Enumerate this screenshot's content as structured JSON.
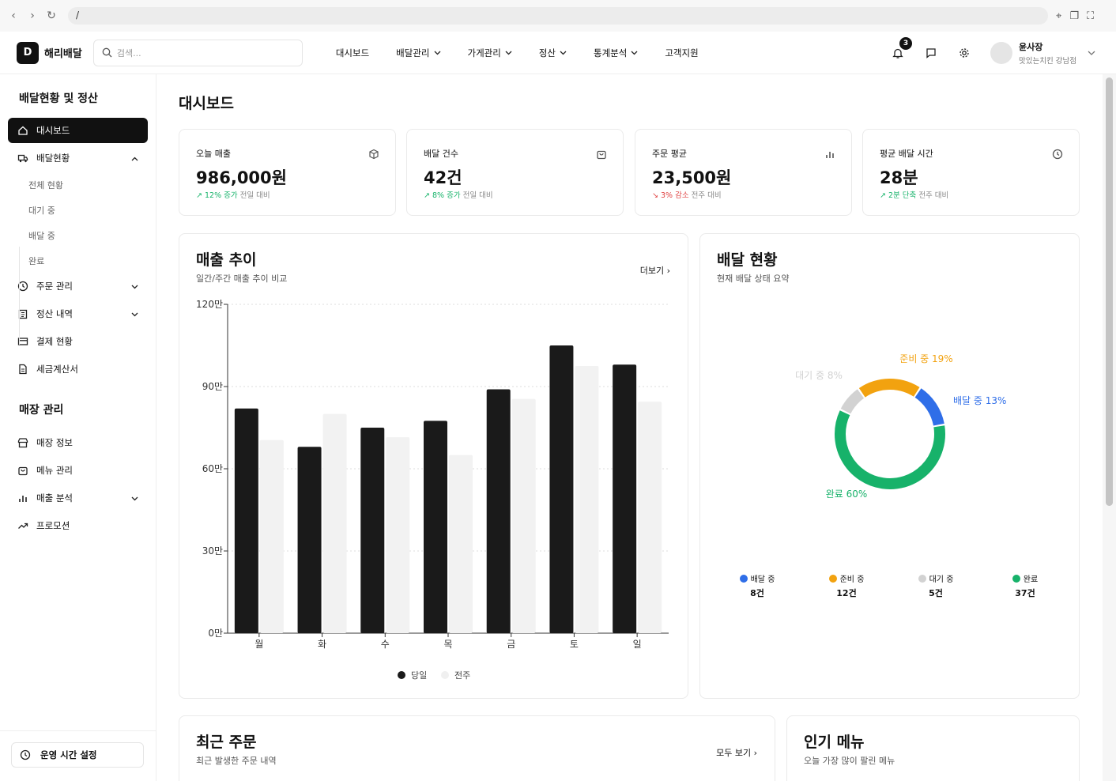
{
  "browser": {
    "url": "/"
  },
  "app": {
    "logo_letter": "D",
    "name": "해리배달",
    "search_placeholder": "검색..."
  },
  "topnav": {
    "items": [
      {
        "label": "대시보드",
        "dropdown": false
      },
      {
        "label": "배달관리",
        "dropdown": true
      },
      {
        "label": "가게관리",
        "dropdown": true
      },
      {
        "label": "정산",
        "dropdown": true
      },
      {
        "label": "통계분석",
        "dropdown": true
      },
      {
        "label": "고객지원",
        "dropdown": false
      }
    ],
    "notification_count": "3",
    "user_name": "윤사장",
    "user_store": "맛있는치킨 강남점"
  },
  "sidebar": {
    "section1_title": "배달현황 및 정산",
    "items": [
      {
        "label": "대시보드",
        "icon": "home-icon",
        "active": true
      },
      {
        "label": "배달현황",
        "icon": "truck-icon",
        "arrow": "up"
      },
      {
        "label": "주문 관리",
        "icon": "clock-icon",
        "arrow": "down"
      },
      {
        "label": "정산 내역",
        "icon": "clipboard-icon",
        "arrow": "down"
      },
      {
        "label": "결제 현황",
        "icon": "card-icon"
      },
      {
        "label": "세금계산서",
        "icon": "document-icon"
      }
    ],
    "sub_items": [
      "전체 현황",
      "대기 중",
      "배달 중",
      "완료"
    ],
    "section2_title": "매장 관리",
    "store_items": [
      {
        "label": "매장 정보",
        "icon": "store-icon"
      },
      {
        "label": "메뉴 관리",
        "icon": "bag-icon"
      },
      {
        "label": "매출 분석",
        "icon": "bar-chart-icon",
        "arrow": "down"
      },
      {
        "label": "프로모션",
        "icon": "trend-icon"
      }
    ],
    "footer_button": "운영 시간 설정"
  },
  "page": {
    "title": "대시보드"
  },
  "kpis": [
    {
      "label": "오늘 매출",
      "value": "986,000원",
      "delta": "12% 증가",
      "note": "전일 대비",
      "trend": "up",
      "icon": "box-icon"
    },
    {
      "label": "배달 건수",
      "value": "42건",
      "delta": "8% 증가",
      "note": "전일 대비",
      "trend": "up",
      "icon": "bag-icon"
    },
    {
      "label": "주문 평균",
      "value": "23,500원",
      "delta": "3% 감소",
      "note": "전주 대비",
      "trend": "down",
      "icon": "bar-chart-icon"
    },
    {
      "label": "평균 배달 시간",
      "value": "28분",
      "delta": "2분 단축",
      "note": "전주 대비",
      "trend": "up",
      "icon": "clock-icon"
    }
  ],
  "sales": {
    "title": "매출 추이",
    "subtitle": "일간/주간 매출 추이 비교",
    "more": "더보기",
    "legend": [
      "당일",
      "전주"
    ]
  },
  "delivery": {
    "title": "배달 현황",
    "subtitle": "현재 배달 상태 요약",
    "legend": [
      {
        "label": "배달 중",
        "count": "8건",
        "color": "#2f6ee8"
      },
      {
        "label": "준비 중",
        "count": "12건",
        "color": "#f2a20f"
      },
      {
        "label": "대기 중",
        "count": "5건",
        "color": "#d2d2d2"
      },
      {
        "label": "완료",
        "count": "37건",
        "color": "#17b26a"
      }
    ],
    "labels": {
      "waiting": "대기 중 8%",
      "preparing": "준비 중 19%",
      "delivering": "배달 중 13%",
      "done": "완료 60%"
    }
  },
  "recent": {
    "title": "최근 주문",
    "subtitle": "최근 발생한 주문 내역",
    "more": "모두 보기"
  },
  "popular": {
    "title": "인기 메뉴",
    "subtitle": "오늘 가장 많이 팔린 메뉴"
  },
  "chart_data": [
    {
      "type": "bar",
      "categories": [
        "월",
        "화",
        "수",
        "목",
        "금",
        "토",
        "일"
      ],
      "series": [
        {
          "name": "당일",
          "values": [
            820000,
            680000,
            750000,
            775000,
            890000,
            1050000,
            980000
          ],
          "color": "#1a1a1a"
        },
        {
          "name": "전주",
          "values": [
            705000,
            800000,
            715000,
            650000,
            855000,
            975000,
            845000
          ],
          "color": "#f2f2f2"
        }
      ],
      "y_ticks": [
        "0만",
        "30만",
        "60만",
        "90만",
        "120만"
      ],
      "ylim": [
        0,
        1200000
      ],
      "grid": true,
      "legend": "bottom"
    },
    {
      "type": "pie",
      "style": "donut",
      "categories": [
        "준비 중",
        "배달 중",
        "완료",
        "대기 중"
      ],
      "values": [
        19,
        13,
        60,
        8
      ],
      "colors": [
        "#f2a20f",
        "#2f6ee8",
        "#17b26a",
        "#d2d2d2"
      ]
    }
  ]
}
